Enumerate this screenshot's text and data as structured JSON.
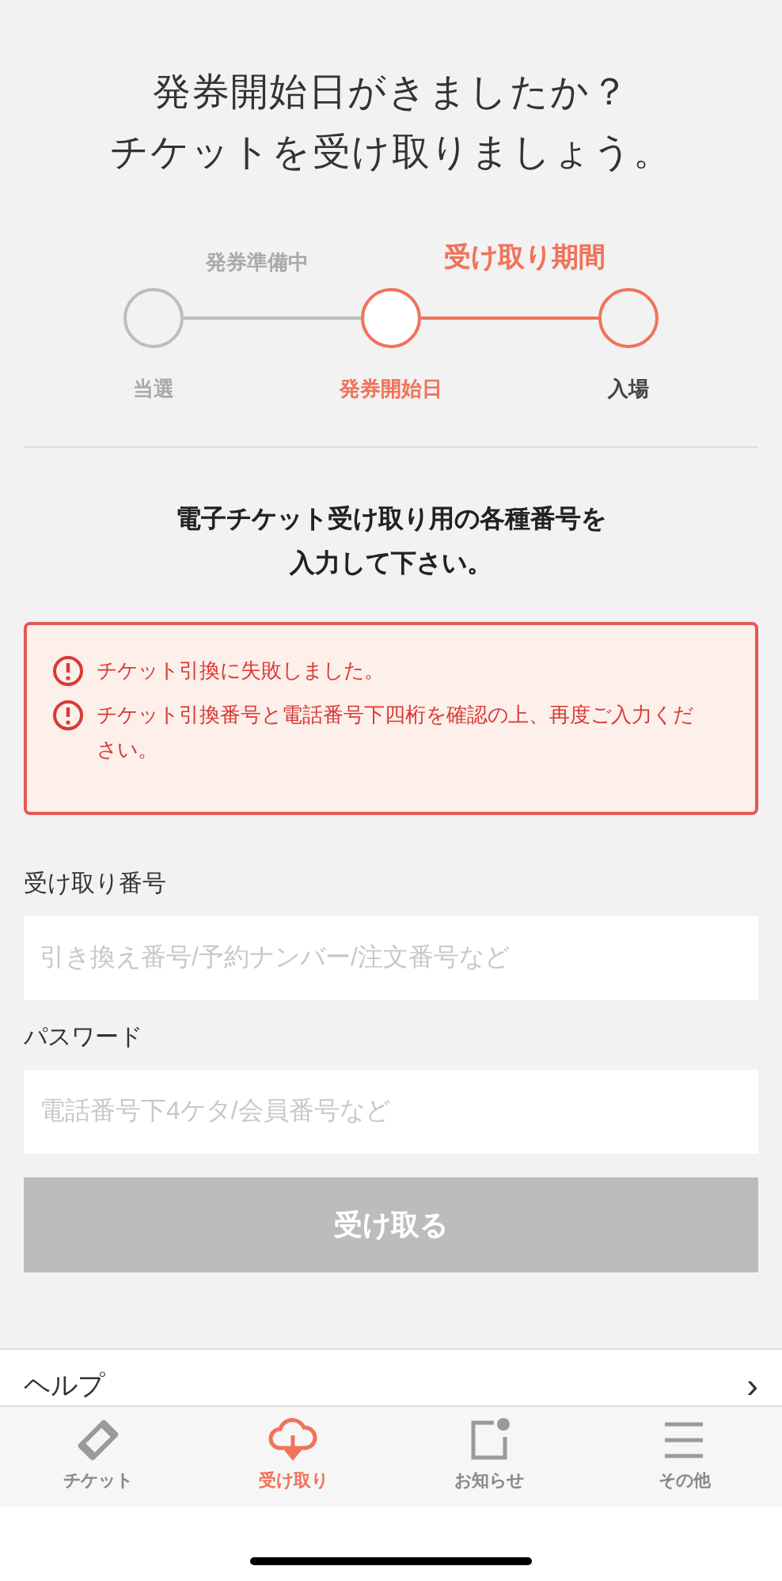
{
  "heading": [
    "発券開始日がきましたか？",
    "チケットを受け取りましょう。"
  ],
  "stepper": {
    "segments": [
      {
        "label": "発券準備中",
        "active": false
      },
      {
        "label": "受け取り期間",
        "active": true
      }
    ],
    "steps": [
      {
        "label": "当選",
        "active": false,
        "selected": false
      },
      {
        "label": "発券開始日",
        "active": true,
        "selected": true
      },
      {
        "label": "入場",
        "active": true,
        "selected": false
      }
    ]
  },
  "instruction": [
    "電子チケット受け取り用の各種番号を",
    "入力して下さい。"
  ],
  "errors": [
    "チケット引換に失敗しました。",
    "チケット引換番号と電話番号下四桁を確認の上、再度ご入力ください。"
  ],
  "fields": [
    {
      "label": "受け取り番号",
      "placeholder": "引き換え番号/予約ナンバー/注文番号など"
    },
    {
      "label": "パスワード",
      "placeholder": "電話番号下4ケタ/会員番号など"
    }
  ],
  "submit": {
    "label": "受け取る",
    "disabled": true
  },
  "help": {
    "label": "ヘルプ",
    "chevron": "›"
  },
  "tabs": [
    {
      "label": "チケット",
      "kind": "ticket",
      "selected": false
    },
    {
      "label": "受け取り",
      "kind": "cloud",
      "selected": true
    },
    {
      "label": "お知らせ",
      "kind": "notice",
      "selected": false
    },
    {
      "label": "その他",
      "kind": "menu",
      "selected": false
    }
  ]
}
